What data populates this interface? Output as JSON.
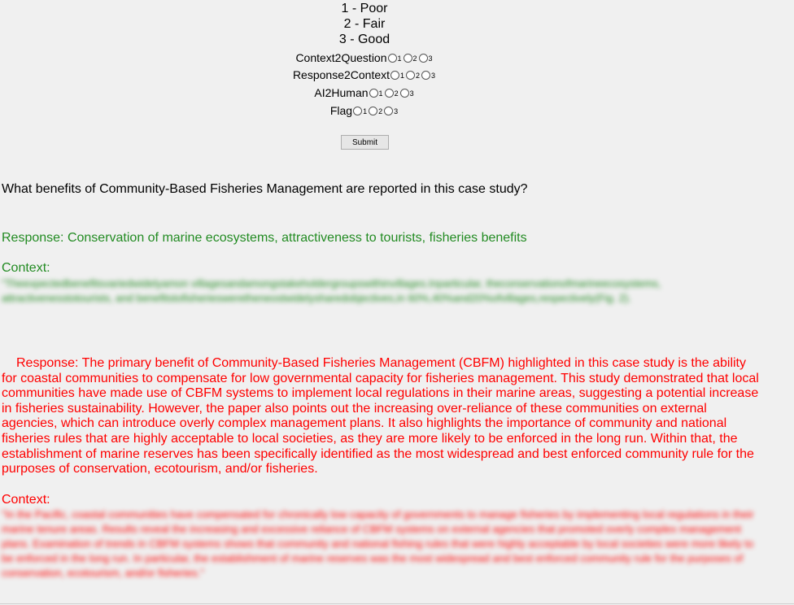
{
  "legend": {
    "scale": [
      "1 - Poor",
      "2 - Fair",
      "3 - Good"
    ]
  },
  "ratings": [
    {
      "label": "Context2Question",
      "options": [
        "1",
        "2",
        "3"
      ]
    },
    {
      "label": "Response2Context",
      "options": [
        "1",
        "2",
        "3"
      ]
    },
    {
      "label": "AI2Human",
      "options": [
        "1",
        "2",
        "3"
      ]
    },
    {
      "label": "Flag",
      "options": [
        "1",
        "2",
        "3"
      ]
    }
  ],
  "submit_label": "Submit",
  "question": "What benefits of Community-Based Fisheries Management are reported in this case study?",
  "answer1": {
    "response": "Response: Conservation of marine ecosystems, attractiveness to tourists, fisheries benefits",
    "context_label": "Context:",
    "context_text": "\"Theexpectedbenefitsvariedwidelyamon villagesandamongstakeholdergroupswithinvillages.Inparticular, theconservationofmarineecosystems, attractivenesstotourists, and benefitstofisheriesweretheneostwidelysharedobjectives,in 60%,40%and20%ofvillages,respectively(Fig. 2)."
  },
  "answer2": {
    "response": "Response: The primary benefit of Community-Based Fisheries Management (CBFM) highlighted in this case study is the ability for coastal communities to compensate for low governmental capacity for fisheries management. This study demonstrated that local communities have made use of CBFM systems to implement local regulations in their marine areas, suggesting a potential increase in fisheries sustainability. However, the paper also points out the increasing over-reliance of these communities on external agencies, which can introduce overly complex management plans. It also highlights the importance of community and national fisheries rules that are highly acceptable to local societies, as they are more likely to be enforced in the long run. Within that, the establishment of marine reserves has been specifically identified as the most widespread and best enforced community rule for the purposes of conservation, ecotourism, and/or fisheries.",
    "context_label": "Context:",
    "context_text": "\"In the Pacific, coastal communities have compensated for chronically low capacity of governments to manage fisheries by implementing local regulations in their marine tenure areas. Results reveal the increasing and excessive reliance of CBFM systems on external agencies that promoted overly complex management plans. Examination of trends in CBFM systems shows that community and national fishing rules that were highly acceptable by local societies were more likely to be enforced in the long run. In particular, the establishment of marine reserves was the most widespread and best enforced community rule for the purposes of conservation, ecotourism, and/or fisheries.\""
  },
  "colors": {
    "background": "#f0f0f0",
    "answer1": "#228b22",
    "answer2": "#ff0000"
  }
}
